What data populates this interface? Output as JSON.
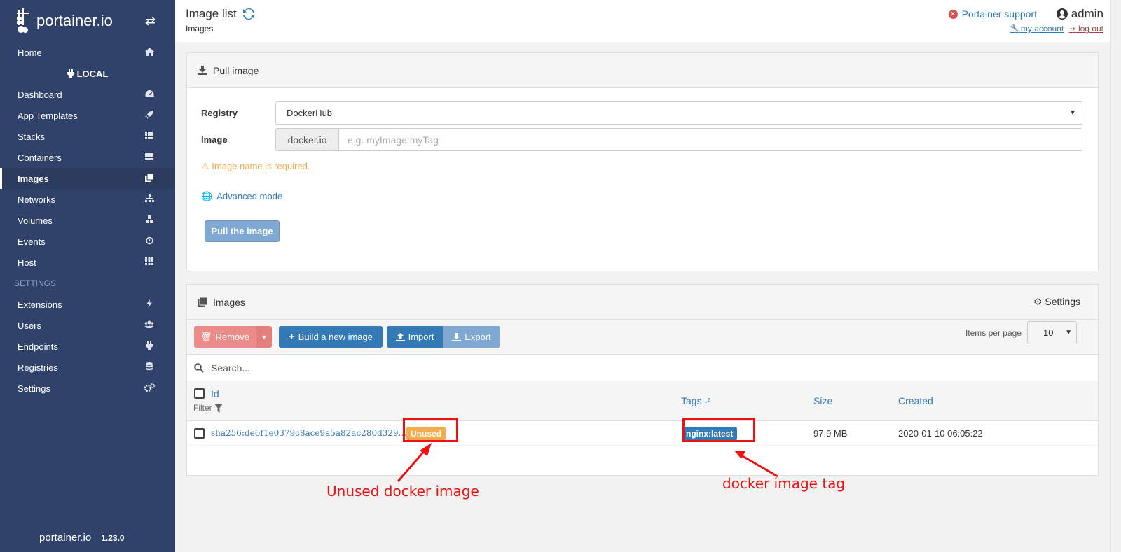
{
  "sidebar": {
    "brand": "portainer.io",
    "toggle_icon": "⇄",
    "items_top": [
      {
        "label": "Home",
        "icon": "home-icon"
      }
    ],
    "endpoint_label": "LOCAL",
    "items": [
      {
        "label": "Dashboard",
        "icon": "tachometer-icon"
      },
      {
        "label": "App Templates",
        "icon": "rocket-icon"
      },
      {
        "label": "Stacks",
        "icon": "th-list-icon"
      },
      {
        "label": "Containers",
        "icon": "server-icon"
      },
      {
        "label": "Images",
        "icon": "clone-icon",
        "active": true
      },
      {
        "label": "Networks",
        "icon": "sitemap-icon"
      },
      {
        "label": "Volumes",
        "icon": "cubes-icon"
      },
      {
        "label": "Events",
        "icon": "history-icon"
      },
      {
        "label": "Host",
        "icon": "th-icon"
      }
    ],
    "settings_heading": "SETTINGS",
    "settings_items": [
      {
        "label": "Extensions",
        "icon": "bolt-icon"
      },
      {
        "label": "Users",
        "icon": "users-icon"
      },
      {
        "label": "Endpoints",
        "icon": "plug-icon"
      },
      {
        "label": "Registries",
        "icon": "database-icon"
      },
      {
        "label": "Settings",
        "icon": "cogs-icon"
      }
    ],
    "footer_brand": "portainer.io",
    "version": "1.23.0"
  },
  "header": {
    "title": "Image list",
    "breadcrumb": "Images",
    "support": "Portainer support",
    "username": "admin",
    "my_account": "my account",
    "log_out": "log out"
  },
  "pull": {
    "title": "Pull image",
    "registry_label": "Registry",
    "registry_value": "DockerHub",
    "image_label": "Image",
    "image_prefix": "docker.io",
    "image_placeholder": "e.g. myImage:myTag",
    "warning": "Image name is required.",
    "advanced": "Advanced mode",
    "button": "Pull the image"
  },
  "images": {
    "title": "Images",
    "settings": "Settings",
    "buttons": {
      "remove": "Remove",
      "build": "Build a new image",
      "import": "Import",
      "export": "Export"
    },
    "search_placeholder": "Search...",
    "columns": {
      "id": "Id",
      "filter": "Filter",
      "tags": "Tags",
      "size": "Size",
      "created": "Created"
    },
    "rows": [
      {
        "id": "sha256:de6f1e0379c8ace9a5a82ac280d329...",
        "badge": "Unused",
        "tag": "nginx:latest",
        "size": "97.9 MB",
        "created": "2020-01-10 06:05:22"
      }
    ],
    "items_per_page_label": "Items per page",
    "items_per_page_value": "10"
  },
  "annotations": {
    "unused": "Unused docker image",
    "tag": "docker image tag"
  },
  "colors": {
    "sidebar_bg": "#30426a",
    "primary": "#337ab7",
    "danger": "#d9534f",
    "warning": "#f0ad4e",
    "annotation_red": "#ee1111"
  }
}
